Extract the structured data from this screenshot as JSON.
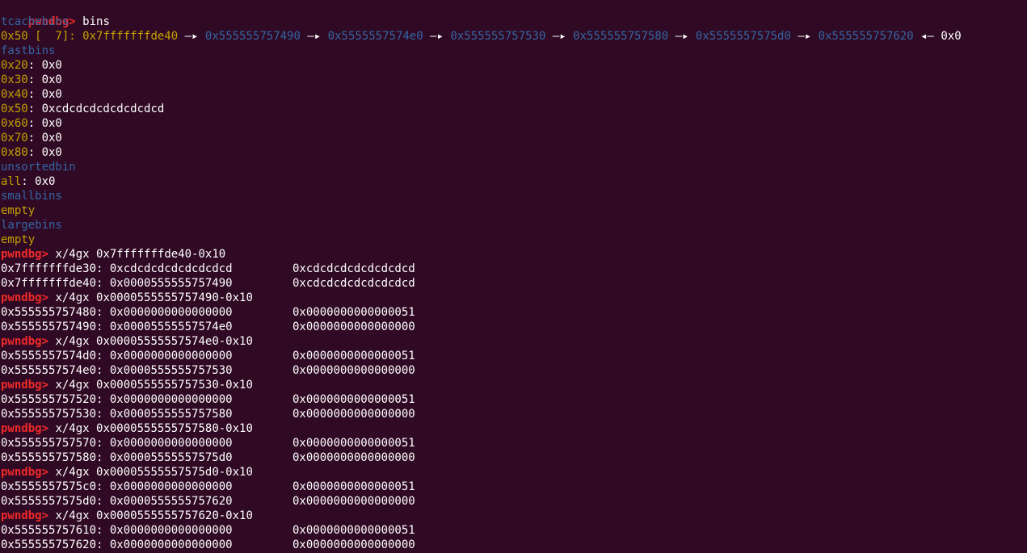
{
  "colors": {
    "background": "#300a24",
    "prompt": "#ef2929",
    "text": "#ffffff",
    "heading": "#3465a4",
    "size_key": "#c4a000"
  },
  "prompt": "pwndbg>",
  "cmd_bins": "bins",
  "tcache": {
    "title": "tcachebins",
    "size_label": "0x50 [  7]:",
    "head": "0x7fffffffde40",
    "chain": [
      "0x555555757490",
      "0x5555557574e0",
      "0x555555757530",
      "0x555555757580",
      "0x5555557575d0",
      "0x555555757620"
    ],
    "tail": "0x0",
    "arrow": "—▸",
    "back_arrow": "◂—"
  },
  "fastbins": {
    "title": "fastbins",
    "entries": [
      {
        "size": "0x20",
        "value": "0x0"
      },
      {
        "size": "0x30",
        "value": "0x0"
      },
      {
        "size": "0x40",
        "value": "0x0"
      },
      {
        "size": "0x50",
        "value": "0xcdcdcdcdcdcdcdcd"
      },
      {
        "size": "0x60",
        "value": "0x0"
      },
      {
        "size": "0x70",
        "value": "0x0"
      },
      {
        "size": "0x80",
        "value": "0x0"
      }
    ]
  },
  "unsortedbin": {
    "title": "unsortedbin",
    "key": "all",
    "value": "0x0"
  },
  "smallbins": {
    "title": "smallbins",
    "value": "empty"
  },
  "largebins": {
    "title": "largebins",
    "value": "empty"
  },
  "dumps": [
    {
      "cmd": "x/4gx 0x7fffffffde40-0x10",
      "rows": [
        {
          "addr": "0x7fffffffde30:",
          "v1": "0xcdcdcdcdcdcdcdcd",
          "v2": "0xcdcdcdcdcdcdcdcd"
        },
        {
          "addr": "0x7fffffffde40:",
          "v1": "0x0000555555757490",
          "v2": "0xcdcdcdcdcdcdcdcd"
        }
      ]
    },
    {
      "cmd": "x/4gx 0x0000555555757490-0x10",
      "rows": [
        {
          "addr": "0x555555757480:",
          "v1": "0x0000000000000000",
          "v2": "0x0000000000000051"
        },
        {
          "addr": "0x555555757490:",
          "v1": "0x00005555557574e0",
          "v2": "0x0000000000000000"
        }
      ]
    },
    {
      "cmd": "x/4gx 0x00005555557574e0-0x10",
      "rows": [
        {
          "addr": "0x5555557574d0:",
          "v1": "0x0000000000000000",
          "v2": "0x0000000000000051"
        },
        {
          "addr": "0x5555557574e0:",
          "v1": "0x0000555555757530",
          "v2": "0x0000000000000000"
        }
      ]
    },
    {
      "cmd": "x/4gx 0x0000555555757530-0x10",
      "rows": [
        {
          "addr": "0x555555757520:",
          "v1": "0x0000000000000000",
          "v2": "0x0000000000000051"
        },
        {
          "addr": "0x555555757530:",
          "v1": "0x0000555555757580",
          "v2": "0x0000000000000000"
        }
      ]
    },
    {
      "cmd": "x/4gx 0x0000555555757580-0x10",
      "rows": [
        {
          "addr": "0x555555757570:",
          "v1": "0x0000000000000000",
          "v2": "0x0000000000000051"
        },
        {
          "addr": "0x555555757580:",
          "v1": "0x00005555557575d0",
          "v2": "0x0000000000000000"
        }
      ]
    },
    {
      "cmd": "x/4gx 0x00005555557575d0-0x10",
      "rows": [
        {
          "addr": "0x5555557575c0:",
          "v1": "0x0000000000000000",
          "v2": "0x0000000000000051"
        },
        {
          "addr": "0x5555557575d0:",
          "v1": "0x0000555555757620",
          "v2": "0x0000000000000000"
        }
      ]
    },
    {
      "cmd": "x/4gx 0x0000555555757620-0x10",
      "rows": [
        {
          "addr": "0x555555757610:",
          "v1": "0x0000000000000000",
          "v2": "0x0000000000000051"
        },
        {
          "addr": "0x555555757620:",
          "v1": "0x0000000000000000",
          "v2": "0x0000000000000000"
        }
      ]
    }
  ]
}
